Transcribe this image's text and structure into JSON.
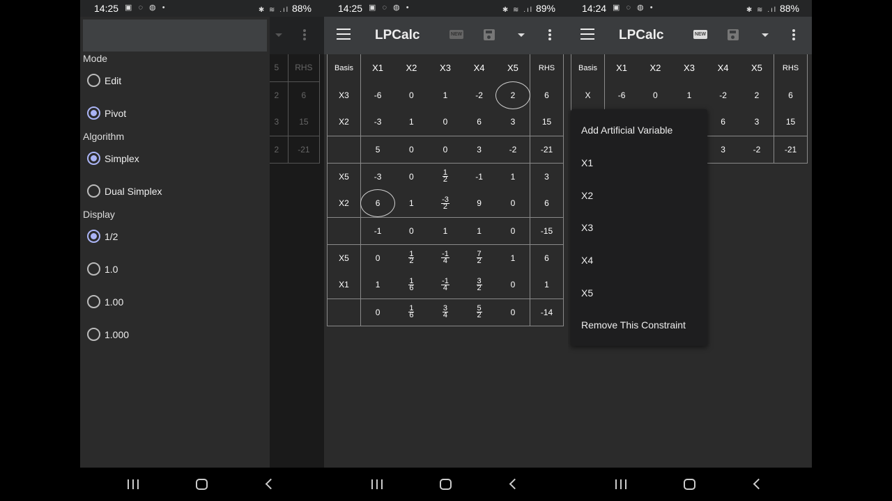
{
  "phone1": {
    "status": {
      "time": "14:25",
      "icons": "▣ ◌ ◍ •",
      "glyphs": "✱ ≋ .ıl",
      "battery": "88%"
    },
    "drawer": {
      "mode_title": "Mode",
      "mode_options": [
        {
          "label": "Edit",
          "selected": false
        },
        {
          "label": "Pivot",
          "selected": true
        }
      ],
      "algorithm_title": "Algorithm",
      "algorithm_options": [
        {
          "label": "Simplex",
          "selected": true
        },
        {
          "label": "Dual Simplex",
          "selected": false
        }
      ],
      "display_title": "Display",
      "display_options": [
        {
          "label": "1/2",
          "selected": true
        },
        {
          "label": "1.0",
          "selected": false
        },
        {
          "label": "1.00",
          "selected": false
        },
        {
          "label": "1.000",
          "selected": false
        }
      ]
    },
    "behind": {
      "c1": "5",
      "rhs_header": "RHS",
      "r1a": "2",
      "r1b": "6",
      "r2a": "3",
      "r2b": "15",
      "r3a": "2",
      "r3b": "-21"
    }
  },
  "phone2": {
    "status": {
      "time": "14:25",
      "icons": "▣ ◌ ◍ •",
      "glyphs": "✱ ≋ .ıl",
      "battery": "89%"
    },
    "appbar": {
      "title": "LPCalc",
      "new_label": "NEW"
    },
    "table": {
      "headers": [
        "Basis",
        "X1",
        "X2",
        "X3",
        "X4",
        "X5",
        "RHS"
      ],
      "b1": {
        "r1": {
          "basis": "X3",
          "c": [
            "-6",
            "0",
            "1",
            "-2",
            "2"
          ],
          "rhs": "6"
        },
        "r2": {
          "basis": "X2",
          "c": [
            "-3",
            "1",
            "0",
            "6",
            "3"
          ],
          "rhs": "15"
        },
        "obj": {
          "c": [
            "5",
            "0",
            "0",
            "3",
            "-2"
          ],
          "rhs": "-21"
        }
      },
      "b2": {
        "r1": {
          "basis": "X5",
          "c1": "-3",
          "c2": "0",
          "c3n": "1",
          "c3d": "2",
          "c4": "-1",
          "c5": "1",
          "rhs": "3"
        },
        "r2": {
          "basis": "X2",
          "c1": "6",
          "c2": "1",
          "c3n": "-3",
          "c3d": "2",
          "c4": "9",
          "c5": "0",
          "rhs": "6"
        },
        "obj": {
          "c": [
            "-1",
            "0",
            "1",
            "1",
            "0"
          ],
          "rhs": "-15"
        }
      },
      "b3": {
        "r1": {
          "basis": "X5",
          "c1": "0",
          "c2n": "1",
          "c2d": "2",
          "c3n": "-1",
          "c3d": "4",
          "c4n": "7",
          "c4d": "2",
          "c5": "1",
          "rhs": "6"
        },
        "r2": {
          "basis": "X1",
          "c1": "1",
          "c2n": "1",
          "c2d": "6",
          "c3n": "-1",
          "c3d": "4",
          "c4n": "3",
          "c4d": "2",
          "c5": "0",
          "rhs": "1"
        },
        "obj": {
          "c1": "0",
          "c2n": "1",
          "c2d": "6",
          "c3n": "3",
          "c3d": "4",
          "c4n": "5",
          "c4d": "2",
          "c5": "0",
          "rhs": "-14"
        }
      }
    }
  },
  "phone3": {
    "status": {
      "time": "14:24",
      "icons": "▣ ◌ ◍ •",
      "glyphs": "✱ ≋ .ıl",
      "battery": "88%"
    },
    "appbar": {
      "title": "LPCalc",
      "new_label": "NEW"
    },
    "table": {
      "headers": [
        "Basis",
        "X1",
        "X2",
        "X3",
        "X4",
        "X5",
        "RHS"
      ],
      "r1": {
        "basis": "X",
        "c": [
          "-6",
          "0",
          "1",
          "-2",
          "2"
        ],
        "rhs": "6"
      },
      "r2": {
        "c4": "6",
        "c5": "3",
        "rhs": "15"
      },
      "obj": {
        "c4": "3",
        "c5": "-2",
        "rhs": "-21"
      }
    },
    "menu": [
      "Add Artificial Variable",
      "X1",
      "X2",
      "X3",
      "X4",
      "X5",
      "Remove This Constraint"
    ]
  }
}
